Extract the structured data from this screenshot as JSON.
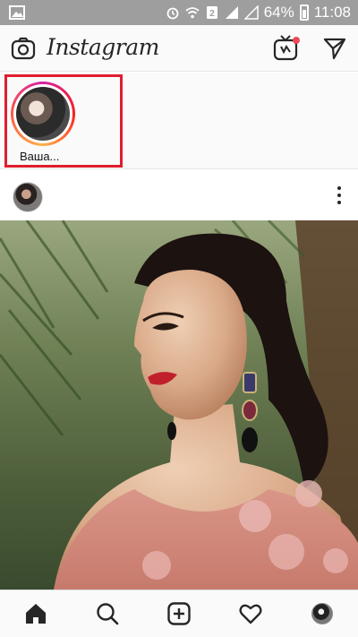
{
  "status_bar": {
    "battery_percent": "64%",
    "time": "11:08",
    "icons": [
      "image-icon",
      "alarm-icon",
      "wifi-icon",
      "sim-2-icon",
      "signal-icon",
      "signal-icon",
      "battery-icon"
    ]
  },
  "header": {
    "logo_text": "Instagram",
    "icons": [
      "camera-icon",
      "igtv-icon",
      "direct-message-icon"
    ],
    "notification_color": "#ed4956"
  },
  "stories": {
    "items": [
      {
        "label": "Ваша...",
        "ring_colors": [
          "#d6249f",
          "#fd1d1d",
          "#fcb045"
        ]
      }
    ],
    "highlight_color": "#e01e2d"
  },
  "post": {
    "header_icons": [
      "avatar",
      "more-options-icon"
    ]
  },
  "bottom_nav": {
    "items": [
      "home-icon",
      "search-icon",
      "new-post-icon",
      "activity-heart-icon",
      "profile-avatar"
    ]
  }
}
